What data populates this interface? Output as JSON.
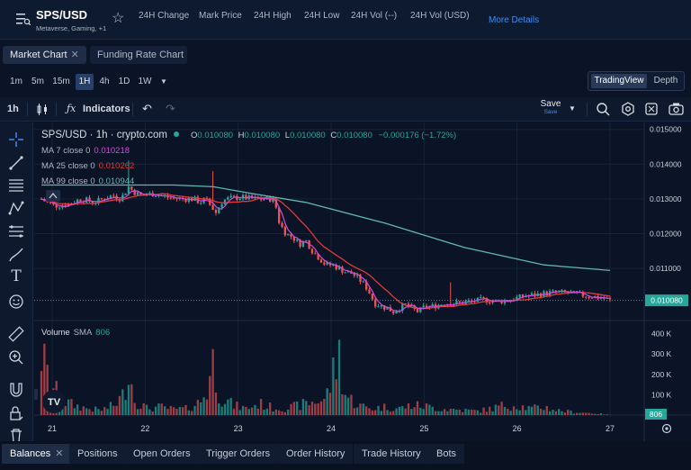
{
  "header": {
    "pair": "SPS/USD",
    "subtitle": "Metaverse, Gaming, +1",
    "stats": [
      "24H Change",
      "Mark Price",
      "24H High",
      "24H Low",
      "24H Vol (--)",
      "24H Vol (USD)"
    ],
    "more_details": "More Details"
  },
  "chart_tabs": {
    "market": "Market Chart",
    "funding": "Funding Rate Chart",
    "close_glyph": "✕"
  },
  "intervals": [
    "1m",
    "5m",
    "15m",
    "1H",
    "4h",
    "1D",
    "1W"
  ],
  "active_interval": "1H",
  "view_toggle": {
    "tradingview": "TradingView",
    "depth": "Depth"
  },
  "toolbar": {
    "interval": "1h",
    "indicators": "Indicators",
    "save": "Save",
    "save_sub": "Save"
  },
  "legend": {
    "symbol": "SPS/USD · 1h · crypto.com",
    "o_label": "O",
    "o": "0.010080",
    "h_label": "H",
    "h": "0.010080",
    "l_label": "L",
    "l": "0.010080",
    "c_label": "C",
    "c": "0.010080",
    "change": "−0.000176 (−1.72%)",
    "ma7_label": "MA 7 close 0",
    "ma7": "0.010218",
    "ma25_label": "MA 25 close 0",
    "ma25": "0.010262",
    "ma99_label": "MA 99 close 0",
    "ma99": "0.010944",
    "volume_label": "Volume",
    "volume_sma_label": "SMA",
    "volume_sma": "806"
  },
  "colors": {
    "up": "#26a69a",
    "down": "#ef5350",
    "ma7": "#d34bd6",
    "ma25": "#e03a3a",
    "ma99": "#5fb7b0",
    "accent": "#3d8ef0",
    "bg": "#0b1426"
  },
  "bottom_tabs": [
    "Balances",
    "Positions",
    "Open Orders",
    "Trigger Orders",
    "Order History",
    "Trade History",
    "Bots"
  ],
  "chart_data": {
    "type": "candlestick",
    "x_ticks": [
      "21",
      "22",
      "23",
      "24",
      "25",
      "26",
      "27"
    ],
    "price_ticks": [
      "0.015000",
      "0.014000",
      "0.013000",
      "0.012000",
      "0.011000"
    ],
    "price_ylim": [
      0.0095,
      0.0152
    ],
    "last_price_label": "0.010080",
    "volume_ticks": [
      "400 K",
      "300 K",
      "200 K",
      "100 K"
    ],
    "volume_ylim": [
      0,
      420000
    ],
    "volume_last_label": "806",
    "price_path": [
      [
        0,
        0.013
      ],
      [
        4,
        0.0129
      ],
      [
        10,
        0.0128
      ],
      [
        20,
        0.01285
      ],
      [
        30,
        0.013
      ],
      [
        40,
        0.0129
      ],
      [
        50,
        0.01305
      ],
      [
        55,
        0.0131
      ],
      [
        60,
        0.013
      ],
      [
        66,
        0.01335
      ],
      [
        70,
        0.0132
      ],
      [
        75,
        0.0131
      ],
      [
        85,
        0.01315
      ],
      [
        95,
        0.01305
      ],
      [
        105,
        0.013
      ],
      [
        115,
        0.013
      ],
      [
        120,
        0.0129
      ],
      [
        124,
        0.013
      ],
      [
        128,
        0.0128
      ],
      [
        132,
        0.0126
      ],
      [
        136,
        0.0129
      ],
      [
        140,
        0.013
      ],
      [
        150,
        0.01305
      ],
      [
        160,
        0.013
      ],
      [
        170,
        0.013
      ],
      [
        175,
        0.013
      ],
      [
        178,
        0.0127
      ],
      [
        180,
        0.0123
      ],
      [
        185,
        0.012
      ],
      [
        190,
        0.0119
      ],
      [
        195,
        0.0117
      ],
      [
        200,
        0.0118
      ],
      [
        205,
        0.0115
      ],
      [
        210,
        0.0113
      ],
      [
        215,
        0.0111
      ],
      [
        220,
        0.0111
      ],
      [
        225,
        0.011
      ],
      [
        230,
        0.0109
      ],
      [
        235,
        0.01085
      ],
      [
        240,
        0.0107
      ],
      [
        245,
        0.0105
      ],
      [
        248,
        0.0103
      ],
      [
        252,
        0.01
      ],
      [
        258,
        0.0099
      ],
      [
        262,
        0.00985
      ],
      [
        266,
        0.00975
      ],
      [
        270,
        0.00985
      ],
      [
        275,
        0.00995
      ],
      [
        280,
        0.00985
      ],
      [
        285,
        0.00975
      ],
      [
        290,
        0.0099
      ],
      [
        295,
        0.0099
      ],
      [
        305,
        0.01
      ],
      [
        315,
        0.01
      ],
      [
        325,
        0.01005
      ],
      [
        335,
        0.0101
      ],
      [
        345,
        0.01005
      ],
      [
        355,
        0.0101
      ],
      [
        365,
        0.0102
      ],
      [
        375,
        0.01025
      ],
      [
        385,
        0.0103
      ],
      [
        395,
        0.0103
      ],
      [
        405,
        0.01025
      ],
      [
        415,
        0.0102
      ],
      [
        425,
        0.01015
      ],
      [
        430,
        0.01008
      ]
    ],
    "spikes": [
      [
        66,
        0.0141
      ],
      [
        130,
        0.0138
      ],
      [
        310,
        0.0106
      ]
    ],
    "candle_count": 190,
    "ma99": [
      [
        0,
        0.0134
      ],
      [
        60,
        0.0134
      ],
      [
        100,
        0.0134
      ],
      [
        130,
        0.01335
      ],
      [
        160,
        0.01315
      ],
      [
        200,
        0.0129
      ],
      [
        260,
        0.0123
      ],
      [
        320,
        0.0116
      ],
      [
        380,
        0.0111
      ],
      [
        430,
        0.01094
      ]
    ],
    "volume_profile": [
      [
        0,
        380000
      ],
      [
        5,
        220000
      ],
      [
        15,
        90000
      ],
      [
        25,
        60000
      ],
      [
        35,
        40000
      ],
      [
        45,
        30000
      ],
      [
        55,
        60000
      ],
      [
        62,
        120000
      ],
      [
        66,
        310000
      ],
      [
        70,
        100000
      ],
      [
        80,
        40000
      ],
      [
        90,
        50000
      ],
      [
        100,
        35000
      ],
      [
        110,
        40000
      ],
      [
        120,
        80000
      ],
      [
        125,
        150000
      ],
      [
        130,
        330000
      ],
      [
        135,
        120000
      ],
      [
        145,
        60000
      ],
      [
        155,
        40000
      ],
      [
        165,
        70000
      ],
      [
        175,
        45000
      ],
      [
        185,
        40000
      ],
      [
        195,
        60000
      ],
      [
        205,
        80000
      ],
      [
        215,
        100000
      ],
      [
        220,
        230000
      ],
      [
        225,
        380000
      ],
      [
        230,
        120000
      ],
      [
        240,
        60000
      ],
      [
        250,
        40000
      ],
      [
        260,
        50000
      ],
      [
        270,
        40000
      ],
      [
        280,
        60000
      ],
      [
        290,
        55000
      ],
      [
        300,
        40000
      ],
      [
        310,
        35000
      ],
      [
        320,
        30000
      ],
      [
        330,
        25000
      ],
      [
        340,
        40000
      ],
      [
        350,
        60000
      ],
      [
        360,
        60000
      ],
      [
        370,
        40000
      ],
      [
        380,
        50000
      ],
      [
        390,
        30000
      ],
      [
        400,
        20000
      ],
      [
        410,
        15000
      ],
      [
        420,
        10000
      ],
      [
        430,
        806
      ]
    ]
  }
}
